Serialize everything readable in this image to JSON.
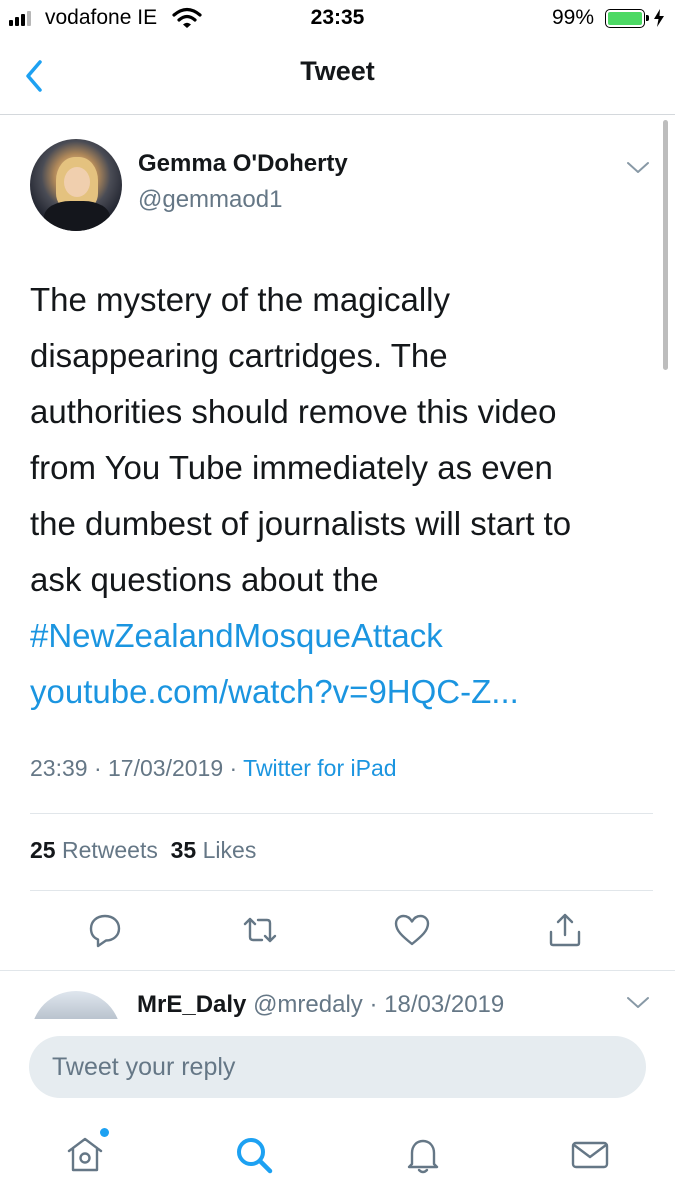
{
  "status_bar": {
    "carrier": "vodafone IE",
    "time": "23:35",
    "battery": "99%"
  },
  "nav": {
    "title": "Tweet",
    "back_icon": "chevron-left-icon"
  },
  "tweet": {
    "author_name": "Gemma O'Doherty",
    "author_handle": "@gemmaod1",
    "text_lines": [
      "The mystery of the magically",
      "disappearing cartridges. The",
      "authorities should remove this video",
      "from You Tube immediately as even",
      "the dumbest of journalists will start to",
      "ask questions about the"
    ],
    "hashtag": "#NewZealandMosqueAttack",
    "link": "youtube.com/watch?v=9HQC-Z...",
    "time": "23:39",
    "date": "17/03/2019",
    "source": "Twitter for iPad",
    "retweet_count": "25",
    "retweet_label": "Retweets",
    "like_count": "35",
    "like_label": "Likes"
  },
  "actions": [
    "reply-icon",
    "retweet-icon",
    "heart-icon",
    "share-icon"
  ],
  "reply_preview": {
    "name": "MrE_Daly",
    "handle": "@mredaly",
    "date": "18/03/2019"
  },
  "compose": {
    "placeholder": "Tweet your reply"
  },
  "tab_bar": [
    "home-icon",
    "search-icon",
    "notifications-icon",
    "messages-icon"
  ],
  "colors": {
    "accent": "#1da1f2",
    "link": "#1b95e0",
    "secondary_text": "#657786",
    "battery": "#4cd964"
  }
}
